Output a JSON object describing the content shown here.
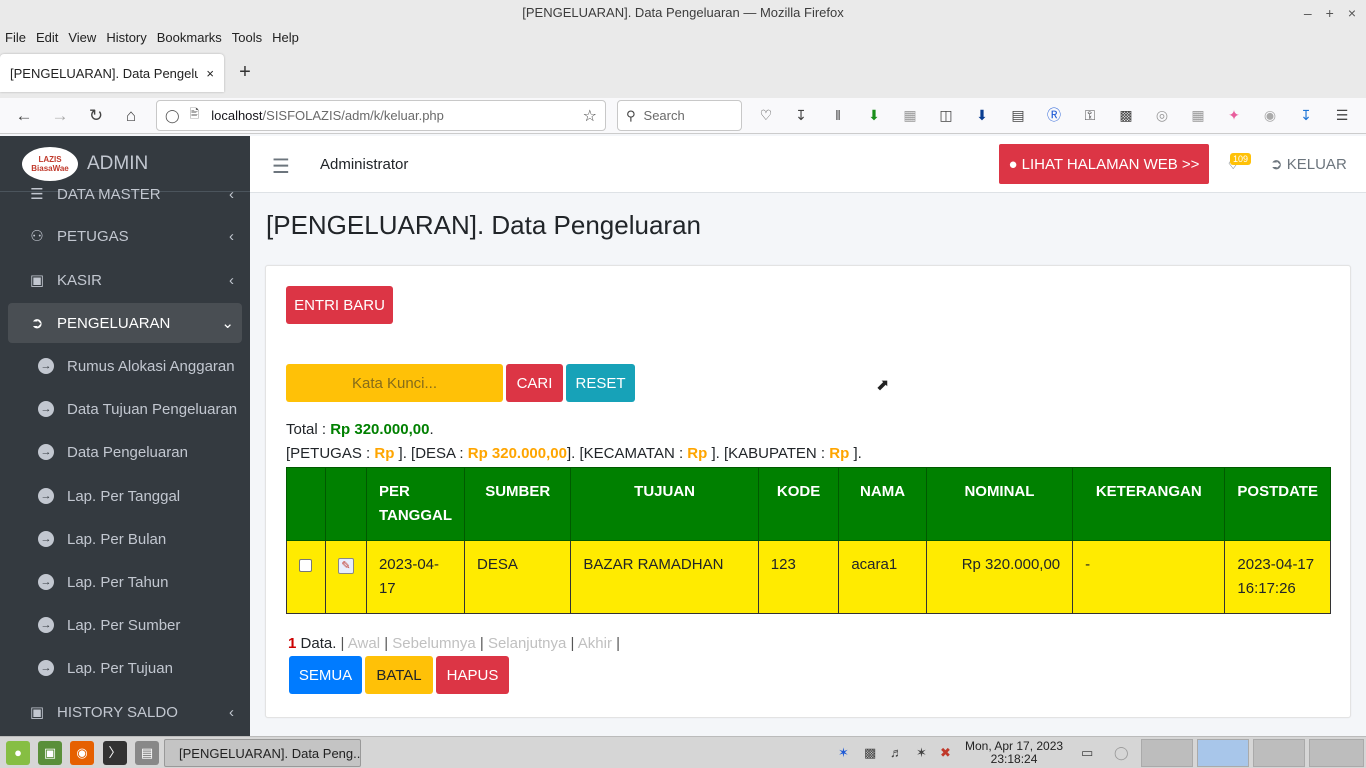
{
  "window": {
    "title": "[PENGELUARAN]. Data Pengeluaran — Mozilla Firefox",
    "controls": [
      "–",
      "+",
      "×"
    ]
  },
  "menubar": [
    "File",
    "Edit",
    "View",
    "History",
    "Bookmarks",
    "Tools",
    "Help"
  ],
  "tab": {
    "title": "[PENGELUARAN]. Data Pengeluaran",
    "close": "×",
    "new_tab": "+"
  },
  "urlbar": {
    "host": "localhost",
    "path": "/SISFOLAZIS/adm/k/keluar.php"
  },
  "searchbar": {
    "placeholder": "Search"
  },
  "brand": {
    "logo_top": "LAZIS",
    "logo_bottom": "BiasaWae",
    "title": "ADMIN"
  },
  "sidebar": {
    "items": [
      {
        "label": "DATA MASTER",
        "icon": "database-icon"
      },
      {
        "label": "PETUGAS",
        "icon": "users-icon"
      },
      {
        "label": "KASIR",
        "icon": "cash-icon"
      },
      {
        "label": "PENGELUARAN",
        "icon": "sign-out-icon"
      },
      {
        "label": "HISTORY SALDO",
        "icon": "briefcase-icon"
      }
    ],
    "subitems": [
      "Rumus Alokasi Anggaran",
      "Data Tujuan Pengeluaran",
      "Data Pengeluaran",
      "Lap. Per Tanggal",
      "Lap. Per Bulan",
      "Lap. Per Tahun",
      "Lap. Per Sumber",
      "Lap. Per Tujuan"
    ]
  },
  "header": {
    "user": "Administrator",
    "web_button": "LIHAT HALAMAN WEB >>",
    "notif_count": "109",
    "logout": "KELUAR"
  },
  "page": {
    "title": "[PENGELUARAN]. Data Pengeluaran"
  },
  "toolbar": {
    "new_entry": "ENTRI BARU",
    "search_placeholder": "Kata Kunci...",
    "search_btn": "CARI",
    "reset_btn": "RESET"
  },
  "totals": {
    "total_label": "Total :",
    "total_value": "Rp 320.000,00",
    "petugas_label": "[PETUGAS :",
    "petugas_value": "Rp",
    "desa_label": "]. [DESA :",
    "desa_value": "Rp 320.000,00",
    "kecamatan_label": "]. [KECAMATAN :",
    "kecamatan_value": "Rp",
    "kabupaten_label": "]. [KABUPATEN :",
    "kabupaten_value": "Rp",
    "end": "]."
  },
  "table": {
    "headers": [
      "",
      "",
      "PER TANGGAL",
      "SUMBER",
      "TUJUAN",
      "KODE",
      "NAMA",
      "NOMINAL",
      "KETERANGAN",
      "POSTDATE"
    ],
    "rows": [
      {
        "tanggal": "2023-04-17",
        "sumber": "DESA",
        "tujuan": "BAZAR RAMADHAN",
        "kode": "123",
        "nama": "acara1",
        "nominal": "Rp 320.000,00",
        "keterangan": "-",
        "postdate_date": "2023-04-17",
        "postdate_time": "16:17:26"
      }
    ]
  },
  "pager": {
    "count": "1",
    "data_label": "Data.",
    "first": "Awal",
    "prev": "Sebelumnya",
    "next": "Selanjutnya",
    "last": "Akhir"
  },
  "actions": {
    "all": "SEMUA",
    "cancel": "BATAL",
    "delete": "HAPUS"
  },
  "taskbar": {
    "task_title": "[PENGELUARAN]. Data Peng...",
    "clock_date": "Mon, Apr 17, 2023",
    "clock_time": "23:18:24"
  },
  "colors": {
    "sidebar": "#343a40",
    "table_header": "#008000",
    "table_row": "#ffeb00",
    "danger": "#dc3545",
    "info": "#17a2b8",
    "warning": "#ffc107",
    "primary": "#007bff"
  }
}
